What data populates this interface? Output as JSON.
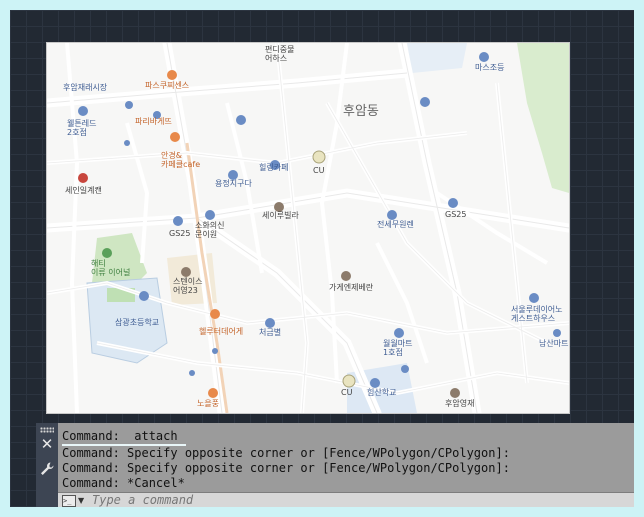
{
  "map": {
    "labels": {
      "top_center": "편디중물\n어하스",
      "restaurant": "후암재래시장",
      "franchise": "파스쿠찌센스",
      "welcome": "웰튼레드\n2호점",
      "paris": "파리바게뜨",
      "cafe": "안경&\n카페클cafe",
      "church": "세인일계캔",
      "cu": "CU",
      "hill": "힐링카페",
      "gs": "GS25",
      "store": "용정지구다",
      "apt": "세이루빌라",
      "district": "후암동",
      "sohwa": "소화의신\n문이원",
      "gs2": "GS25",
      "bus": "전세무원렌",
      "park": "해티\n이류 이어널",
      "school": "삼광초등학교",
      "station": "스텐이스\n어영23",
      "center": "가게엔제베란",
      "gym": "헬루터데어게",
      "meeting": "처금별",
      "library": "서울루데이어노\n게스트하우스",
      "dental": "남산마트",
      "mart": "월월마트\n1호점",
      "cu2": "CU",
      "hill2": "힘산학교",
      "post": "노을풍",
      "bank": "마스조등",
      "office": "후암영재"
    }
  },
  "command": {
    "history": [
      "Command:  attach",
      "Command: Specify opposite corner or [Fence/WPolygon/CPolygon]:",
      "Command: Specify opposite corner or [Fence/WPolygon/CPolygon]:",
      "Command: *Cancel*"
    ],
    "input_placeholder": "Type a command",
    "input_value": ""
  },
  "icons": {
    "close": "close-icon",
    "settings": "wrench-icon",
    "prompt": "command-prompt-icon"
  },
  "colors": {
    "canvas_bg": "#222933",
    "outer_bg": "#cdf3f6",
    "command_panel": "#9b9b9b",
    "command_side": "#3d4553"
  }
}
